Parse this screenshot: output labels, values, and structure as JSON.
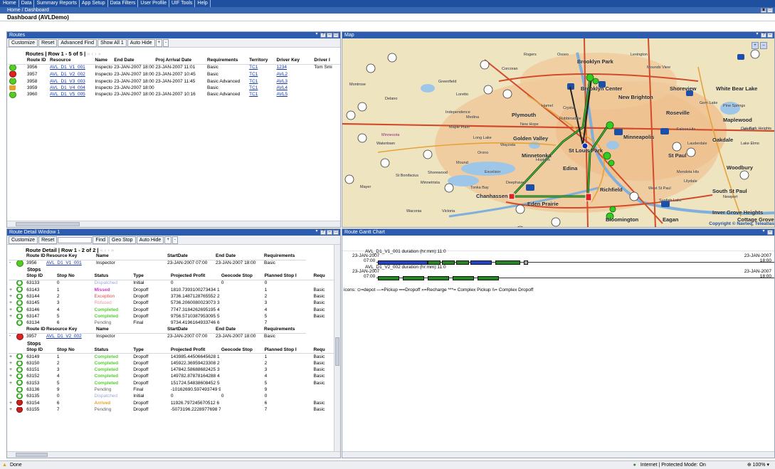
{
  "menu": [
    "Home",
    "Data",
    "Summary Reports",
    "App Setup",
    "Data Filters",
    "User Profile",
    "UIF Tools",
    "Help"
  ],
  "breadcrumb": "Home / Dashboard",
  "page_title": "Dashboard (AVLDemo)",
  "routes": {
    "title": "Routes",
    "toolbar": [
      "Customize",
      "Reset",
      "Advanced Find",
      "Show All 1",
      "Auto Hide",
      "+",
      "-"
    ],
    "caption": "Routes | Row 1 - 5 of 5 |",
    "caption_nav": "« ‹ › »",
    "columns": [
      "Route ID",
      "Resource",
      "Name",
      "End Date",
      "Proj Arrival Date",
      "Requirements",
      "Territory",
      "Driver Key",
      "Driver I"
    ],
    "rows": [
      {
        "icon": "green",
        "id": "3956",
        "resource": "AVL_D1_V1_001",
        "name": "Inspecto",
        "end": "23-JAN-2007 18:00",
        "proj": "23-JAN-2007 11:01",
        "req": "Basic",
        "territory": "TC1",
        "driver_key": "1234",
        "driver": "Tom Smi"
      },
      {
        "icon": "red",
        "id": "3957",
        "resource": "AVL_D1_V2_002",
        "name": "Inspecto",
        "end": "23-JAN-2007 18:00",
        "proj": "23-JAN-2007 10:45",
        "req": "Basic",
        "territory": "TC1",
        "driver_key": "AVL2",
        "driver": ""
      },
      {
        "icon": "green",
        "id": "3958",
        "resource": "AVL_D1_V3_003",
        "name": "Inspecto",
        "end": "23-JAN-2007 18:00",
        "proj": "23-JAN-2007 11:45",
        "req": "Basic Advanced",
        "territory": "TC1",
        "driver_key": "AVL3",
        "driver": ""
      },
      {
        "icon": "warn",
        "id": "3959",
        "resource": "AVL_D1_V4_004",
        "name": "Inspecto",
        "end": "23-JAN-2007 18:00",
        "proj": "",
        "req": "Basic",
        "territory": "TC1",
        "driver_key": "AVL4",
        "driver": ""
      },
      {
        "icon": "green",
        "id": "3960",
        "resource": "AVL_D1_V5_005",
        "name": "Inspecto",
        "end": "23-JAN-2007 18:00",
        "proj": "23-JAN-2007 10:16",
        "req": "Basic Advanced",
        "territory": "TC1",
        "driver_key": "AVL5",
        "driver": ""
      }
    ]
  },
  "map": {
    "title": "Map",
    "copyright": "Copyright © Navteq, Teleatlas",
    "labels": [
      "Brooklyn Park",
      "Brooklyn Center",
      "Shoreview",
      "White Bear Lake",
      "New Brighton",
      "Roseville",
      "Maplewood",
      "Plymouth",
      "Minneapolis",
      "Golden Valley",
      "St Louis Park",
      "St Paul",
      "Oakdale",
      "Minnetonka",
      "Edina",
      "Richfield",
      "South St Paul",
      "Woodbury",
      "Chanhassen",
      "Eden Prairie",
      "Bloomington",
      "Eagan",
      "Inver Grove Heights",
      "Cottage Grove",
      "Minnesota",
      "Medina",
      "Maple Plain",
      "Corcoran",
      "Osseo",
      "Mounds View",
      "Long Lake",
      "Wayzata",
      "Hopkins",
      "Mendota Hts",
      "West St Paul",
      "Lauderdale",
      "Falcon Hts",
      "Independence",
      "Greenfield",
      "Loretto",
      "Delano",
      "Watertown",
      "Mound",
      "Victoria",
      "Waconia",
      "Shorewood",
      "Deephaven",
      "Excelsior",
      "Tonka Bay",
      "Minnetrista",
      "St Bonifacius",
      "Mayer",
      "Rogers",
      "Lexington",
      "Gem Lake",
      "Pine Springs",
      "Oak Park Heights",
      "Lake Elmo",
      "Landfall",
      "Lilydale",
      "Sunfish Lake",
      "Newport",
      "Crystal",
      "Robbinsdale",
      "New Hope",
      "Orono",
      "Hamel",
      "Montrose"
    ],
    "zoom_buttons": [
      "+",
      "-"
    ]
  },
  "detail": {
    "title": "Route Detail Window 1",
    "toolbar": [
      "Customize",
      "Reset",
      "Find",
      "Geo Stop",
      "Auto Hide",
      "+",
      "-"
    ],
    "caption": "Route Detail | Row 1 - 2 of 2 |",
    "caption_nav": "« ‹ › »",
    "route_columns": [
      "Route ID",
      "Resource Key",
      "Name",
      "StartDate",
      "End Date",
      "Requirements"
    ],
    "stops_label": "Stops",
    "stop_columns": [
      "Stop ID",
      "Stop No",
      "Status",
      "Type",
      "Projected Profit",
      "Geocode Stop",
      "Planned Stop I",
      "Requ"
    ],
    "routes": [
      {
        "icon": "green",
        "id": "3956",
        "resource_key": "AVL_D1_V1_001",
        "name": "Inspector",
        "start": "23-JAN-2007 07:00",
        "end": "23-JAN-2007 18:00",
        "req": "Basic",
        "stops": [
          {
            "icon": "green",
            "expander": "",
            "id": "63133",
            "no": "0",
            "status": "Dispatched",
            "sclass": "st-disp",
            "type": "Initial",
            "profit": "0",
            "geo": "0",
            "planned": "0",
            "req": ""
          },
          {
            "icon": "green",
            "expander": "+",
            "id": "63143",
            "no": "1",
            "status": "Missed",
            "sclass": "st-miss",
            "type": "Dropoff",
            "profit": "1810.7393100273434 1",
            "geo": "",
            "planned": "1",
            "req": "Basic"
          },
          {
            "icon": "green",
            "expander": "+",
            "id": "63144",
            "no": "2",
            "status": "Exception",
            "sclass": "st-exc",
            "type": "Dropoff",
            "profit": "3736.1487128765552 2",
            "geo": "",
            "planned": "2",
            "req": "Basic"
          },
          {
            "icon": "green",
            "expander": "+",
            "id": "63145",
            "no": "3",
            "status": "Refused",
            "sclass": "st-ref",
            "type": "Dropoff",
            "profit": "5736.2060080023073 3",
            "geo": "",
            "planned": "3",
            "req": "Basic"
          },
          {
            "icon": "green",
            "expander": "+",
            "id": "63146",
            "no": "4",
            "status": "Completed",
            "sclass": "st-comp",
            "type": "Dropoff",
            "profit": "7747.3184262695195 4",
            "geo": "",
            "planned": "4",
            "req": "Basic"
          },
          {
            "icon": "green",
            "expander": "+",
            "id": "63147",
            "no": "5",
            "status": "Completed",
            "sclass": "st-comp",
            "type": "Dropoff",
            "profit": "9756.5710387953095 5",
            "geo": "",
            "planned": "5",
            "req": "Basic"
          },
          {
            "icon": "green",
            "expander": "",
            "id": "63134",
            "no": "6",
            "status": "Pending",
            "sclass": "st-pend",
            "type": "Final",
            "profit": "9734.4196164933746 6",
            "geo": "",
            "planned": "7",
            "req": ""
          }
        ]
      },
      {
        "icon": "red",
        "id": "3957",
        "resource_key": "AVL_D1_V2_002",
        "name": "Inspector",
        "start": "23-JAN-2007 07:00",
        "end": "23-JAN-2007 18:00",
        "req": "Basic",
        "stops": [
          {
            "icon": "green",
            "expander": "+",
            "id": "63149",
            "no": "1",
            "status": "Completed",
            "sclass": "st-comp",
            "type": "Dropoff",
            "profit": "143985.44506645628 1",
            "geo": "",
            "planned": "1",
            "req": "Basic"
          },
          {
            "icon": "green",
            "expander": "+",
            "id": "63150",
            "no": "2",
            "status": "Completed",
            "sclass": "st-comp",
            "type": "Dropoff",
            "profit": "145922.36959423308 2",
            "geo": "",
            "planned": "2",
            "req": "Basic"
          },
          {
            "icon": "green",
            "expander": "+",
            "id": "63151",
            "no": "3",
            "status": "Completed",
            "sclass": "st-comp",
            "type": "Dropoff",
            "profit": "147842.58688682425 3",
            "geo": "",
            "planned": "3",
            "req": "Basic"
          },
          {
            "icon": "green",
            "expander": "+",
            "id": "63152",
            "no": "4",
            "status": "Completed",
            "sclass": "st-comp",
            "type": "Dropoff",
            "profit": "149782.87878164288 4",
            "geo": "",
            "planned": "4",
            "req": "Basic"
          },
          {
            "icon": "green",
            "expander": "+",
            "id": "63153",
            "no": "5",
            "status": "Completed",
            "sclass": "st-comp",
            "type": "Dropoff",
            "profit": "151724.54838608452 5",
            "geo": "",
            "planned": "5",
            "req": "Basic"
          },
          {
            "icon": "green",
            "expander": "",
            "id": "63136",
            "no": "9",
            "status": "Pending",
            "sclass": "st-pend",
            "type": "Final",
            "profit": "-10162690.597493749 9",
            "geo": "",
            "planned": "9",
            "req": ""
          },
          {
            "icon": "green",
            "expander": "",
            "id": "63135",
            "no": "0",
            "status": "Dispatched",
            "sclass": "st-disp",
            "type": "Initial",
            "profit": "0",
            "geo": "0",
            "planned": "0",
            "req": ""
          },
          {
            "icon": "red",
            "expander": "+",
            "id": "63154",
            "no": "6",
            "status": "Arrived",
            "sclass": "st-arr",
            "type": "Dropoff",
            "profit": "11926.797245670512 6",
            "geo": "",
            "planned": "6",
            "req": "Basic"
          },
          {
            "icon": "red",
            "expander": "+",
            "id": "63155",
            "no": "7",
            "status": "Pending",
            "sclass": "st-pend",
            "type": "Dropoff",
            "profit": "-5073196.2228977698 7",
            "geo": "",
            "planned": "7",
            "req": "Basic"
          }
        ]
      }
    ]
  },
  "gantt": {
    "title": "Route Gantt Chart",
    "rows": [
      {
        "caption": "AVL_D1_V1_001 duration (hr:mm):11:0",
        "start_label": "23-JAN-2007",
        "start_time": "07:00",
        "end_label": "23-JAN-2007",
        "end_time": "18:00"
      },
      {
        "caption": "AVL_D1_V2_002 duration (hr:mm):11:0",
        "start_label": "23-JAN-2007",
        "start_time": "07:00",
        "end_label": "23-JAN-2007",
        "end_time": "18:00"
      }
    ],
    "legend": "icons: ⊙=depot —=Pickup ═=Dropoff »=Recharge ***= Complex Pickup \\\\= Complex Dropoff"
  },
  "status": {
    "left": "Done",
    "security": "Internet | Protected Mode: On",
    "zoom": "100%"
  },
  "colors": {
    "menubar": "#1f4f9f",
    "panel_title": "#2b5caf",
    "completed": "#55cc33",
    "missed": "#cc33cc",
    "exception": "#e24a4a",
    "arrived": "#e9a030",
    "gantt_dropoff": "#228822",
    "gantt_pickup": "#2244cc"
  }
}
